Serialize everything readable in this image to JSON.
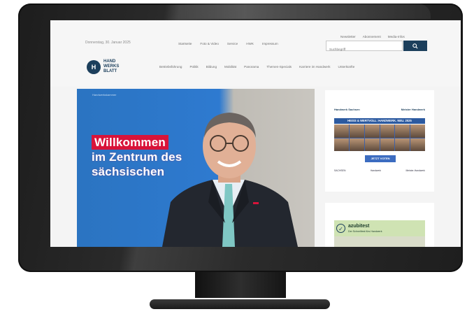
{
  "colors": {
    "brand_navy": "#1c3f5c",
    "hero_blue": "#2e7ad0",
    "hero_red": "#d8143a",
    "ad_green": "#cfe3b3"
  },
  "site": {
    "date": "Donnerstag, 30. Januar 2025",
    "logo": {
      "mark": "H",
      "text": "HAND\nWERKS\nBLATT"
    },
    "utility": [
      "Newsletter",
      "Abonnement",
      "Media-Infos"
    ],
    "topnav": [
      "Startseite",
      "Foto & Video",
      "Service",
      "HWK",
      "Impressum"
    ],
    "search": {
      "placeholder": "Suchbegriff",
      "button_icon": "search-icon"
    },
    "subnav": [
      "Betriebsführung",
      "Politik",
      "Bildung",
      "Mobilität",
      "Panorama",
      "Themen-Specials",
      "Karriere im Handwerk",
      "Unterkünfte"
    ]
  },
  "hero": {
    "banner_label": "Handwerkskammer",
    "lines": [
      "Willkommen",
      "im Zentrum des",
      "sächsischen"
    ]
  },
  "ads": {
    "ad1": {
      "logo_left": "Handwerk Sachsen",
      "logo_right": "Meister Handwerk",
      "band": "HEISS & WERTVOLL: HANDWERK. NEU. 2025",
      "button": "JETZT VOTEN",
      "footer": [
        "SACHSEN",
        "Handwerk",
        "Meister-Handwerk"
      ]
    },
    "ad2": {
      "title": "azubitest",
      "subtitle": "Der Schnelltest fürs Handwerk"
    }
  }
}
